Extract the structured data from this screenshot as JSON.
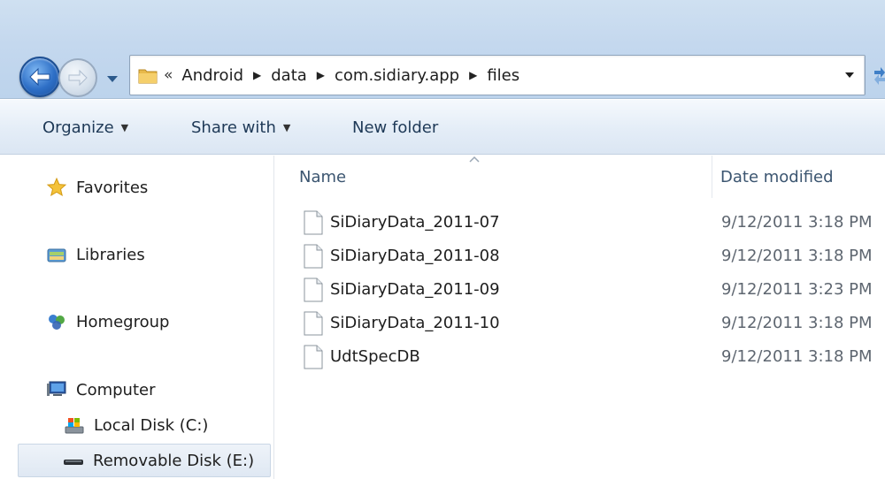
{
  "address_bar": {
    "overflow_glyph": "«",
    "breadcrumbs": [
      "Android",
      "data",
      "com.sidiary.app",
      "files"
    ]
  },
  "command_bar": {
    "organize_label": "Organize",
    "share_with_label": "Share with",
    "new_folder_label": "New folder"
  },
  "navigation_pane": {
    "favorites_label": "Favorites",
    "libraries_label": "Libraries",
    "homegroup_label": "Homegroup",
    "computer_label": "Computer",
    "local_disk_label": "Local Disk (C:)",
    "removable_disk_label": "Removable Disk (E:)"
  },
  "columns": {
    "name_label": "Name",
    "date_modified_label": "Date modified"
  },
  "files": [
    {
      "name": "SiDiaryData_2011-07",
      "date_modified": "9/12/2011 3:18 PM"
    },
    {
      "name": "SiDiaryData_2011-08",
      "date_modified": "9/12/2011 3:18 PM"
    },
    {
      "name": "SiDiaryData_2011-09",
      "date_modified": "9/12/2011 3:23 PM"
    },
    {
      "name": "SiDiaryData_2011-10",
      "date_modified": "9/12/2011 3:18 PM"
    },
    {
      "name": "UdtSpecDB",
      "date_modified": "9/12/2011 3:18 PM"
    }
  ],
  "colors": {
    "frame": "#c4d8ee",
    "back_button": "#2e6fc6",
    "header_text": "#3b5570",
    "date_text": "#5e6670"
  }
}
